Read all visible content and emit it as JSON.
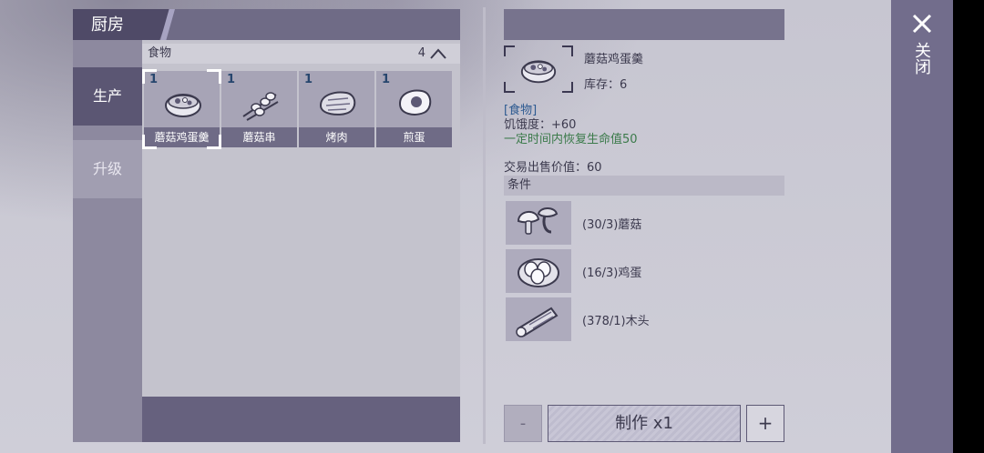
{
  "window": {
    "title": "厨房"
  },
  "side_tabs": [
    {
      "label": "生产",
      "active": true
    },
    {
      "label": "升级",
      "active": false
    }
  ],
  "category": {
    "name": "食物",
    "count": "4"
  },
  "items": [
    {
      "qty": "1",
      "name": "蘑菇鸡蛋羹",
      "icon": "soup-bowl-icon",
      "selected": true
    },
    {
      "qty": "1",
      "name": "蘑菇串",
      "icon": "mushroom-skewer-icon",
      "selected": false
    },
    {
      "qty": "1",
      "name": "烤肉",
      "icon": "roast-meat-icon",
      "selected": false
    },
    {
      "qty": "1",
      "name": "煎蛋",
      "icon": "fried-egg-icon",
      "selected": false
    }
  ],
  "detail": {
    "name": "蘑菇鸡蛋羹",
    "stock": "库存：6",
    "type": "[食物]",
    "hunger": "饥饿度：+60",
    "effect": "一定时间内恢复生命值50",
    "price": "交易出售价值：60",
    "conditions_label": "条件",
    "conditions": [
      {
        "text": "(30/3)蘑菇",
        "icon": "mushroom-icon"
      },
      {
        "text": "(16/3)鸡蛋",
        "icon": "eggs-icon"
      },
      {
        "text": "(378/1)木头",
        "icon": "wood-icon"
      }
    ]
  },
  "actions": {
    "minus": "-",
    "make": "制作 x1",
    "plus": "+"
  },
  "close": {
    "label": "关闭"
  },
  "colors": {
    "panel_dark": "#4f4a67",
    "panel": "#6f6b86",
    "effect_green": "#3b7a4a",
    "type_blue": "#2d5a91"
  }
}
